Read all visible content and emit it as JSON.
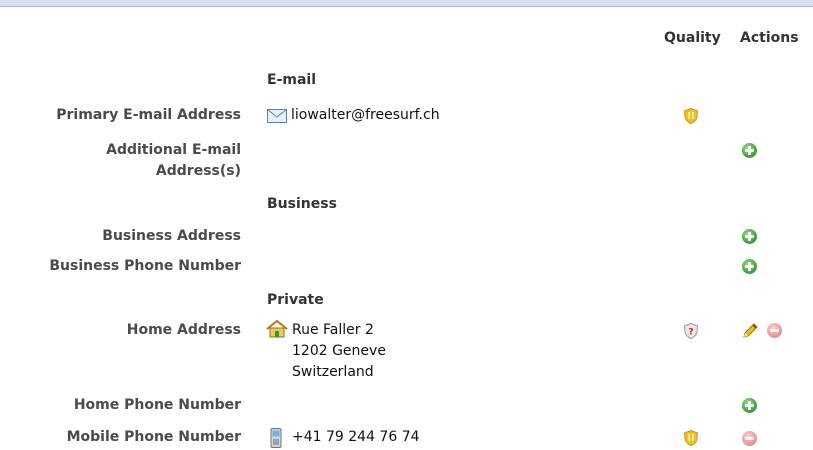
{
  "columns": {
    "quality": "Quality",
    "actions": "Actions"
  },
  "sections": {
    "email": "E-mail",
    "business": "Business",
    "private": "Private"
  },
  "rows": {
    "primary_email": {
      "label": "Primary E-mail Address",
      "value": "liowalter@freesurf.ch",
      "icon": "envelope-icon",
      "quality": "shield-yellow"
    },
    "additional_email": {
      "label_line1": "Additional E-mail",
      "label_line2": "Address(s)"
    },
    "business_address": {
      "label": "Business Address"
    },
    "business_phone": {
      "label": "Business Phone Number"
    },
    "home_address": {
      "label": "Home Address",
      "line1": "Rue Faller 2",
      "line2": "1202 Geneve",
      "line3": "Switzerland",
      "icon": "house-icon",
      "quality": "shield-question"
    },
    "home_phone": {
      "label": "Home Phone Number"
    },
    "mobile_phone": {
      "label": "Mobile Phone Number",
      "value": "+41 79 244 76 74",
      "icon": "mobile-phone-icon",
      "quality": "shield-yellow"
    }
  },
  "colors": {
    "add": "#4aa845",
    "remove": "#e79a9a",
    "shield": "#f2c21b",
    "label": "#4a4a4a"
  }
}
